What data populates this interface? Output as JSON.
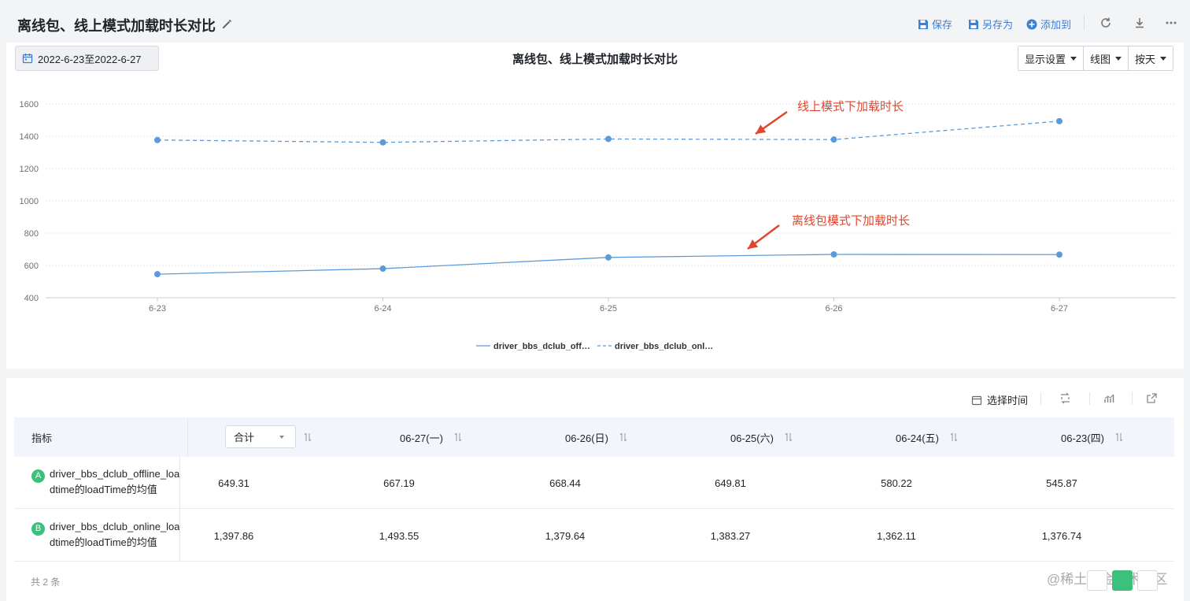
{
  "header": {
    "title": "离线包、线上模式加载时长对比",
    "actions": {
      "save": "保存",
      "save_as": "另存为",
      "add_to": "添加到"
    },
    "icons": [
      "edit-icon",
      "save-icon",
      "save-as-icon",
      "add-icon",
      "refresh-icon",
      "download-icon",
      "more-icon"
    ]
  },
  "chart_panel": {
    "date_range": "2022-6-23至2022-6-27",
    "display_settings": "显示设置",
    "chart_type": "线图",
    "granularity": "按天"
  },
  "chart_data": {
    "type": "line",
    "title": "离线包、线上模式加载时长对比",
    "categories": [
      "6-23",
      "6-24",
      "6-25",
      "6-26",
      "6-27"
    ],
    "y_ticks": [
      "400",
      "600",
      "800",
      "1000",
      "1200",
      "1400",
      "1600"
    ],
    "ylim": [
      400,
      1600
    ],
    "grid": true,
    "legend_position": "bottom",
    "series": [
      {
        "name": "driver_bbs_dclub_off…",
        "style": "solid",
        "color": "#5b9bd9",
        "values": [
          545.87,
          580.22,
          649.81,
          668.44,
          667.19
        ]
      },
      {
        "name": "driver_bbs_dclub_onl…",
        "style": "dashed",
        "color": "#5b9bd9",
        "values": [
          1376.74,
          1362.11,
          1383.27,
          1379.64,
          1493.55
        ]
      }
    ],
    "annotations": [
      {
        "text": "线上模式下加载时长",
        "color": "#e0462c",
        "target": "online"
      },
      {
        "text": "离线包模式下加载时长",
        "color": "#e0462c",
        "target": "offline"
      }
    ]
  },
  "table_panel": {
    "select_time": "选择时间",
    "aggregate_select": "合计",
    "columns": [
      "指标",
      "06-27(一)",
      "06-26(日)",
      "06-25(六)",
      "06-24(五)",
      "06-23(四)"
    ],
    "rows": [
      {
        "badge": "A",
        "name": "driver_bbs_dclub_offline_loadtime的loadTime的均值",
        "total": "649.31",
        "values": [
          "667.19",
          "668.44",
          "649.81",
          "580.22",
          "545.87"
        ]
      },
      {
        "badge": "B",
        "name": "driver_bbs_dclub_online_loadtime的loadTime的均值",
        "total": "1,397.86",
        "values": [
          "1,493.55",
          "1,379.64",
          "1,383.27",
          "1,362.11",
          "1,376.74"
        ]
      }
    ],
    "total_count": "共 2 条"
  },
  "watermark": "@稀土掘金技术社区"
}
